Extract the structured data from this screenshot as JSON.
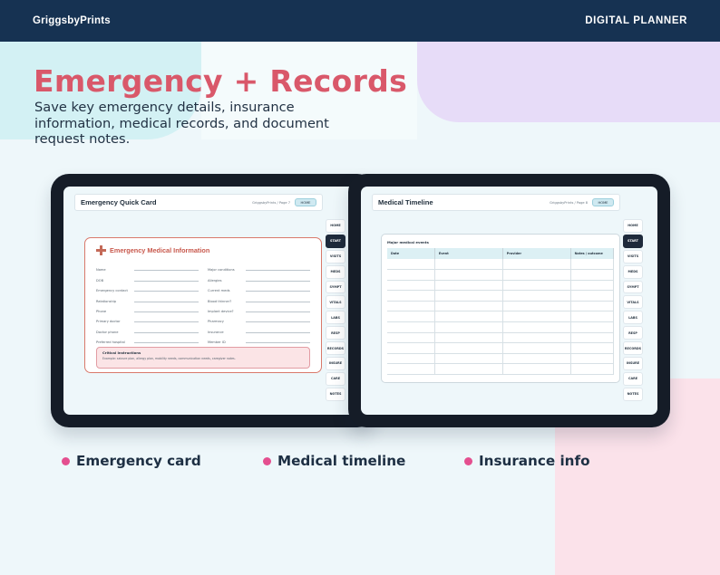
{
  "topbar": {
    "brand": "GriggsbyPrints",
    "product": "DIGITAL PLANNER"
  },
  "hero": {
    "title": "Emergency + Records",
    "subtitle": "Save key emergency details, insurance information, medical records, and document request notes."
  },
  "tabs": [
    "HOME",
    "START",
    "VISITS",
    "MEDS",
    "SYMPT",
    "VITALS",
    "LABS",
    "RESP",
    "RECORDS",
    "INSURE",
    "CARE",
    "NOTES"
  ],
  "active_tab": "START",
  "left_page": {
    "title": "Emergency Quick Card",
    "crumb": "GriggsbyPrints  /  Page 7",
    "home": "HOME",
    "card": {
      "title": "Emergency Medical Information",
      "fields_left": [
        "Name",
        "DOB",
        "Emergency contact",
        "Relationship",
        "Phone",
        "Primary doctor",
        "Doctor phone",
        "Preferred hospital"
      ],
      "fields_right": [
        "Major conditions",
        "Allergies",
        "Current meds",
        "Blood thinner?",
        "Implant device?",
        "Pharmacy",
        "Insurance",
        "Member ID"
      ],
      "critical_title": "Critical Instructions",
      "critical_text": "Example: seizure plan, allergy plan, mobility needs, communication needs, caregiver notes."
    }
  },
  "right_page": {
    "title": "Medical Timeline",
    "crumb": "GriggsbyPrints  /  Page 8",
    "home": "HOME",
    "table_label": "Major medical events",
    "columns": [
      "Date",
      "Event",
      "Provider",
      "Notes / outcome"
    ],
    "empty_rows": 11
  },
  "features": [
    {
      "label": "Emergency card"
    },
    {
      "label": "Medical timeline"
    },
    {
      "label": "Insurance info"
    }
  ],
  "colors": {
    "topbar": "#163252",
    "accent_title": "#d9586a",
    "bullet": "#e44f8f",
    "tab_active": "#1e2a3b"
  }
}
